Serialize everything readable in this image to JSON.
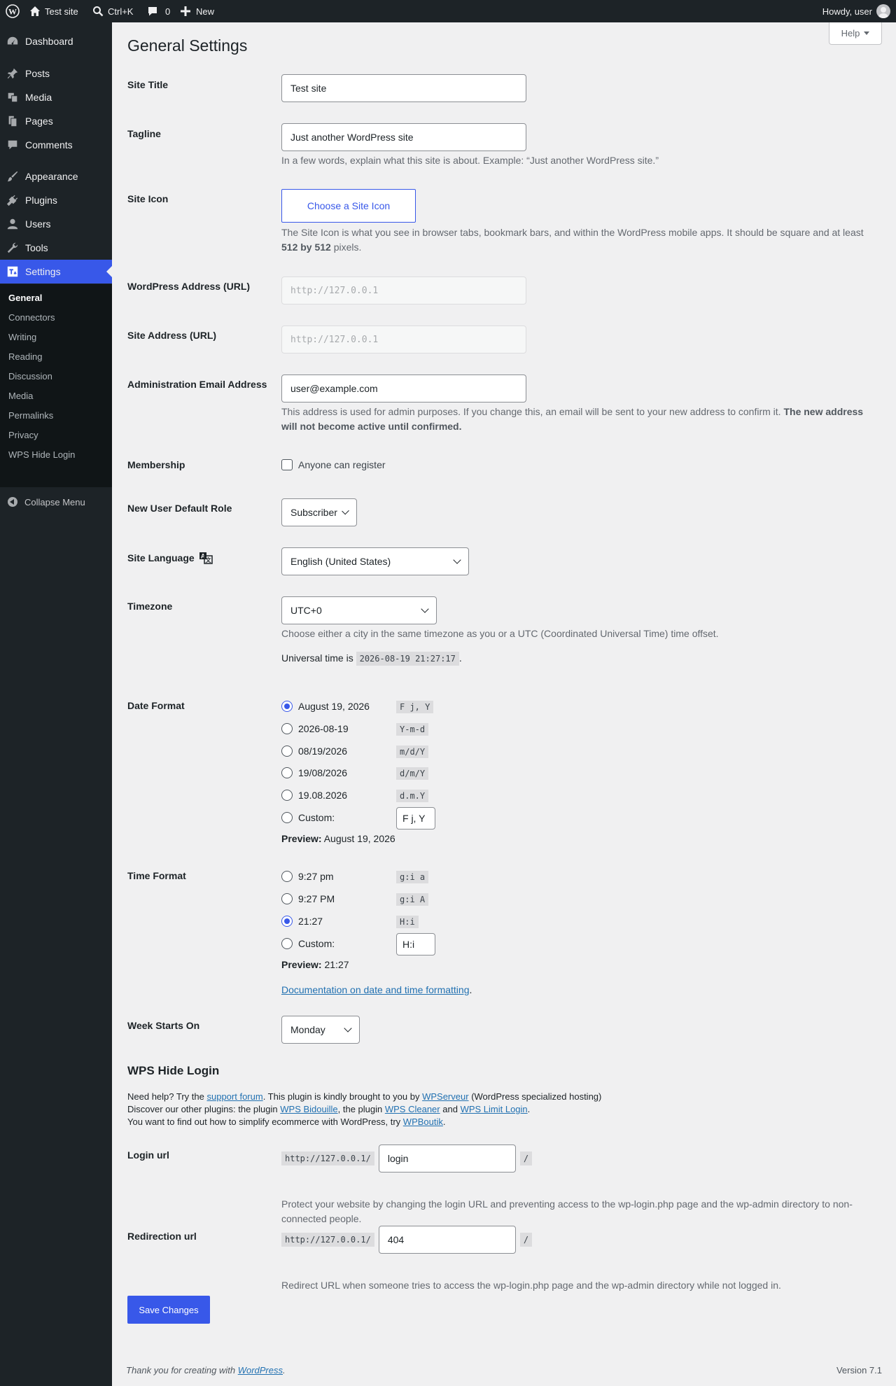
{
  "adminbar": {
    "site_name": "Test site",
    "search_shortcut": "Ctrl+K",
    "comments_count": "0",
    "new_label": "New",
    "howdy": "Howdy, user"
  },
  "sidebar": {
    "items": [
      {
        "label": "Dashboard",
        "icon": "dashboard-icon"
      },
      {
        "label": "Posts",
        "icon": "pin-icon"
      },
      {
        "label": "Media",
        "icon": "media-icon"
      },
      {
        "label": "Pages",
        "icon": "pages-icon"
      },
      {
        "label": "Comments",
        "icon": "comment-icon"
      },
      {
        "label": "Appearance",
        "icon": "brush-icon"
      },
      {
        "label": "Plugins",
        "icon": "plugin-icon"
      },
      {
        "label": "Users",
        "icon": "user-icon"
      },
      {
        "label": "Tools",
        "icon": "wrench-icon"
      },
      {
        "label": "Settings",
        "icon": "settings-icon"
      }
    ],
    "submenu": [
      "General",
      "Connectors",
      "Writing",
      "Reading",
      "Discussion",
      "Media",
      "Permalinks",
      "Privacy",
      "WPS Hide Login"
    ],
    "collapse": "Collapse Menu"
  },
  "help": "Help",
  "page_title": "General Settings",
  "fields": {
    "site_title": {
      "label": "Site Title",
      "value": "Test site"
    },
    "tagline": {
      "label": "Tagline",
      "value": "Just another WordPress site",
      "desc": "In a few words, explain what this site is about. Example: “Just another WordPress site.”"
    },
    "site_icon": {
      "label": "Site Icon",
      "button": "Choose a Site Icon",
      "desc_1": "The Site Icon is what you see in browser tabs, bookmark bars, and within the WordPress mobile apps. It should be square and at least",
      "desc_bold": "512 by 512",
      "desc_2": "pixels."
    },
    "wp_address": {
      "label": "WordPress Address (URL)",
      "value": "http://127.0.0.1"
    },
    "site_address": {
      "label": "Site Address (URL)",
      "value": "http://127.0.0.1"
    },
    "admin_email": {
      "label": "Administration Email Address",
      "value": "user@example.com",
      "desc_1": "This address is used for admin purposes. If you change this, an email will be sent to your new address to confirm it.",
      "desc_bold": "The new address will not become active until confirmed."
    },
    "membership": {
      "label": "Membership",
      "checkbox": "Anyone can register"
    },
    "default_role": {
      "label": "New User Default Role",
      "value": "Subscriber"
    },
    "language": {
      "label": "Site Language",
      "value": "English (United States)"
    },
    "timezone": {
      "label": "Timezone",
      "value": "UTC+0",
      "desc": "Choose either a city in the same timezone as you or a UTC (Coordinated Universal Time) time offset.",
      "universal_label": "Universal time is",
      "universal_value": "2026-08-19 21:27:17"
    },
    "date_format": {
      "label": "Date Format",
      "options": [
        {
          "label": "August 19, 2026",
          "format": "F j, Y",
          "checked": true
        },
        {
          "label": "2026-08-19",
          "format": "Y-m-d",
          "checked": false
        },
        {
          "label": "08/19/2026",
          "format": "m/d/Y",
          "checked": false
        },
        {
          "label": "19/08/2026",
          "format": "d/m/Y",
          "checked": false
        },
        {
          "label": "19.08.2026",
          "format": "d.m.Y",
          "checked": false
        }
      ],
      "custom_label": "Custom:",
      "custom_value": "F j, Y",
      "preview_label": "Preview:",
      "preview_value": "August 19, 2026"
    },
    "time_format": {
      "label": "Time Format",
      "options": [
        {
          "label": "9:27 pm",
          "format": "g:i a",
          "checked": false
        },
        {
          "label": "9:27 PM",
          "format": "g:i A",
          "checked": false
        },
        {
          "label": "21:27",
          "format": "H:i",
          "checked": true
        }
      ],
      "custom_label": "Custom:",
      "custom_value": "H:i",
      "preview_label": "Preview:",
      "preview_value": "21:27",
      "doc_link": "Documentation on date and time formatting"
    },
    "week_start": {
      "label": "Week Starts On",
      "value": "Monday"
    }
  },
  "wps": {
    "heading": "WPS Hide Login",
    "line1_a": "Need help? Try the",
    "line1_link1": "support forum",
    "line1_b": ". This plugin is kindly brought to you by",
    "line1_link2": "WPServeur",
    "line1_c": "(WordPress specialized hosting)",
    "line2_a": "Discover our other plugins: the plugin",
    "line2_link1": "WPS Bidouille",
    "line2_b": ", the plugin",
    "line2_link2": "WPS Cleaner",
    "line2_c": "and",
    "line2_link3": "WPS Limit Login",
    "line2_d": ".",
    "line3_a": "You want to find out how to simplify ecommerce with WordPress, try",
    "line3_link": "WPBoutik",
    "line3_b": ".",
    "login_url": {
      "label": "Login url",
      "prefix": "http://127.0.0.1/",
      "value": "login",
      "suffix": "/",
      "desc": "Protect your website by changing the login URL and preventing access to the wp-login.php page and the wp-admin directory to non-connected people."
    },
    "redirect_url": {
      "label": "Redirection url",
      "prefix": "http://127.0.0.1/",
      "value": "404",
      "suffix": "/",
      "desc": "Redirect URL when someone tries to access the wp-login.php page and the wp-admin directory while not logged in."
    }
  },
  "save_button": "Save Changes",
  "footer": {
    "thanks": "Thank you for creating with",
    "link": "WordPress",
    "thanks_end": ".",
    "version": "Version 7.1"
  },
  "colors": {
    "accent": "#3858e9",
    "adminbar": "#1d2327",
    "background": "#f0f0f1"
  }
}
